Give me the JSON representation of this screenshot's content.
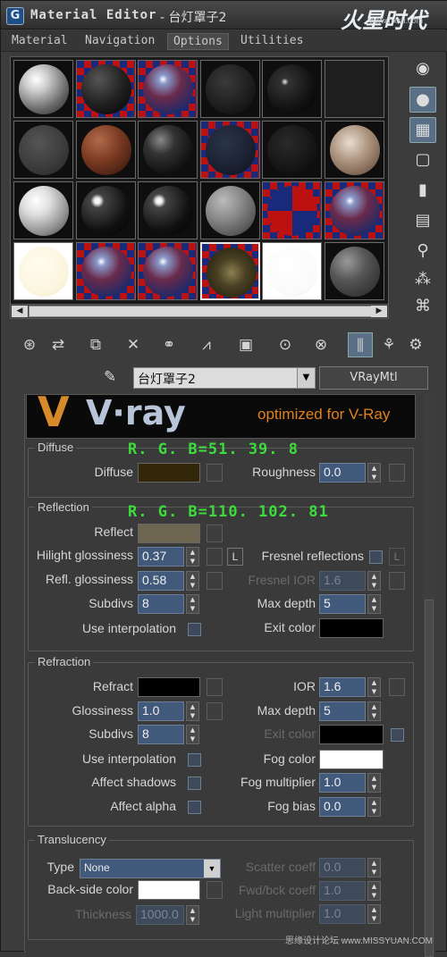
{
  "window": {
    "app_icon": "3ds-max-icon",
    "title": "Material Editor",
    "title_separator": " - ",
    "material_name_in_title": "台灯罩子2",
    "brand": "火星时代",
    "brand_url": "www.hxsd.com"
  },
  "menu": [
    "Material",
    "Navigation",
    "Options",
    "Utilities"
  ],
  "slots": [
    {
      "style": "white-glossy"
    },
    {
      "style": "checker-dark"
    },
    {
      "style": "checker-glass"
    },
    {
      "style": "dark-noise"
    },
    {
      "style": "dark-glossy-small"
    },
    {
      "style": "empty"
    },
    {
      "style": "dark-grey"
    },
    {
      "style": "brown"
    },
    {
      "style": "black-glossy"
    },
    {
      "style": "checker-navy"
    },
    {
      "style": "black-matte"
    },
    {
      "style": "marble"
    },
    {
      "style": "white-grey"
    },
    {
      "style": "black-shiny"
    },
    {
      "style": "black-shiny"
    },
    {
      "style": "grey-matte"
    },
    {
      "style": "checker-bright"
    },
    {
      "style": "checker-glass"
    },
    {
      "style": "cream"
    },
    {
      "style": "checker-glass"
    },
    {
      "style": "checker-glass"
    },
    {
      "style": "wood-selected"
    },
    {
      "style": "white"
    },
    {
      "style": "dark-grey-glossy"
    }
  ],
  "side_tools": [
    "sample-type-icon",
    "backlight-icon",
    "background-checker-icon",
    "sample-uv-tiling-icon",
    "video-color-check-icon",
    "make-preview-icon",
    "options-icon",
    "select-by-material-icon",
    "material-map-navigator-icon"
  ],
  "toolbar": [
    "get-material-icon",
    "put-to-scene-icon",
    "assign-to-selection-icon",
    "reset-map-icon",
    "make-unique-icon",
    "put-to-library-icon",
    "material-effects-channel-icon",
    "show-map-in-viewport-icon",
    "show-end-result-icon",
    "go-to-parent-icon",
    "go-forward-icon",
    "pick-material-icon"
  ],
  "material": {
    "name": "台灯罩子2",
    "type": "VRayMtl"
  },
  "banner": {
    "logo_v": "V",
    "logo_ray": "V·ray",
    "tagline": "optimized for V-Ray"
  },
  "diffuse": {
    "group": "Diffuse",
    "annotation": "R. G. B=51. 39. 8",
    "diffuse_label": "Diffuse",
    "diffuse_color": "#33270a",
    "roughness_label": "Roughness",
    "roughness_value": "0.0"
  },
  "reflection": {
    "group": "Reflection",
    "annotation": "R. G. B=110. 102. 81",
    "reflect_label": "Reflect",
    "reflect_color": "#6e6651",
    "hilight_label": "Hilight glossiness",
    "hilight_value": "0.37",
    "lock_label": "L",
    "fresnel_label": "Fresnel reflections",
    "fresnel_lock": "L",
    "refl_gloss_label": "Refl. glossiness",
    "refl_gloss_value": "0.58",
    "fresnel_ior_label": "Fresnel IOR",
    "fresnel_ior_value": "1.6",
    "subdivs_label": "Subdivs",
    "subdivs_value": "8",
    "max_depth_label": "Max depth",
    "max_depth_value": "5",
    "use_interp_label": "Use interpolation",
    "exit_color_label": "Exit color",
    "exit_color": "#000000"
  },
  "refraction": {
    "group": "Refraction",
    "refract_label": "Refract",
    "refract_color": "#000000",
    "ior_label": "IOR",
    "ior_value": "1.6",
    "glossiness_label": "Glossiness",
    "glossiness_value": "1.0",
    "max_depth_label": "Max depth",
    "max_depth_value": "5",
    "subdivs_label": "Subdivs",
    "subdivs_value": "8",
    "exit_color_label": "Exit color",
    "exit_color": "#000000",
    "use_interp_label": "Use interpolation",
    "fog_color_label": "Fog color",
    "fog_color": "#ffffff",
    "affect_shadows_label": "Affect shadows",
    "fog_mult_label": "Fog multiplier",
    "fog_mult_value": "1.0",
    "affect_alpha_label": "Affect alpha",
    "fog_bias_label": "Fog bias",
    "fog_bias_value": "0.0"
  },
  "translucency": {
    "group": "Translucency",
    "type_label": "Type",
    "type_value": "None",
    "scatter_label": "Scatter coeff",
    "scatter_value": "0.0",
    "backside_label": "Back-side color",
    "backside_color": "#ffffff",
    "fwd_label": "Fwd/bck coeff",
    "fwd_value": "1.0",
    "thickness_label": "Thickness",
    "thickness_value": "1000.0",
    "light_mult_label": "Light multiplier",
    "light_mult_value": "1.0"
  },
  "watermark": "思缘设计论坛 www.MISSYUAN.COM"
}
